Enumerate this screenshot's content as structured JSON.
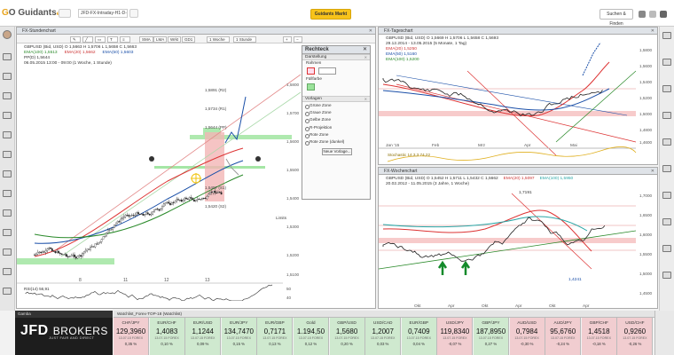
{
  "topbar": {
    "title_field": "JFD-FX-Intraday-H1-D-W",
    "market_button": "Guidants Markt",
    "search_button": "Suchen & Finden"
  },
  "main_chart": {
    "window_title": "FX-Stundenchart",
    "periods": [
      "1 Woche",
      "1 Stunde"
    ],
    "ma_buttons": [
      "SMA",
      "LMA",
      "Wrkt",
      "GD1"
    ],
    "line1": "GBPUSD (Bid, USD) O 1,5663 H 1,5706 L 1,5658 C 1,5663",
    "ema20": "EMA(20) 1,5662",
    "ema50": "EMA(50) 1,5603",
    "ema100": "EMA(100) 1,5513",
    "pp": "PP(D) 1,5644",
    "date": "06.05.2015 13:00 - 09:00 (1 Woche, 1 Stunde)",
    "levels": [
      "1,5891 (R2)",
      "1,5734 (R1)",
      "1,5644 (PP)",
      "1,5497 (S1)",
      "1,5420 (S2)"
    ],
    "yticks": [
      "1,5800",
      "1,5700",
      "1,5600",
      "1,5500",
      "1,5400",
      "1,5300",
      "1,5200",
      "1,5100"
    ],
    "xticks": [
      "8",
      "11",
      "12",
      "13"
    ],
    "rsi_label": "RSI(14) 56,91",
    "rsi_ticks": [
      "50",
      "40"
    ],
    "extra_label": "Limits"
  },
  "rect_panel": {
    "title": "Rechteck",
    "sec_display": "Darstellung",
    "label_frame": "Rahmen",
    "label_fill": "Füllfarbe",
    "sec_templates": "Vorlagen",
    "templates": [
      "Grüne Zone",
      "Graue Zone",
      "Gelbe Zone",
      "R-Projektion",
      "Rote Zone",
      "Rote Zone (dunkel)"
    ],
    "new_button": "Neue Vorlage..."
  },
  "daily_chart": {
    "window_title": "FX-Tageschart",
    "line1": "GBPUSD (Bid, USD) O 1,5669 H 1,5706 L 1,5658 C 1,5693",
    "date": "29.12.2014 - 13.05.2015 (5 Monate, 1 Tag)",
    "ema20": "EMA(20) 1,5250",
    "ema50": "EMA(50) 1,5160",
    "ema100": "EMA(100) 1,5200",
    "yticks": [
      "1,5800",
      "1,5600",
      "1,5400",
      "1,5200",
      "1,5000",
      "1,4800",
      "1,4600"
    ],
    "xticks": [
      "Jan '15",
      "Feb",
      "Mrz",
      "Apr",
      "Mai"
    ],
    "stoch_label": "Stochastic 14,3,3 74,22"
  },
  "weekly_chart": {
    "window_title": "FX-Wochenchart",
    "line1": "GBPUSD (Bid, USD) O 1,5452 H 1,5711 L 1,5432 C 1,5662",
    "date": "20.02.2012 - 11.05.2015 (3 Jahre, 1 Woche)",
    "ema20": "EMA(20) 1,5097",
    "ema100": "EMA(100) 1,5950",
    "high_label": "1,7191",
    "low_label": "1,4241",
    "yticks": [
      "1,7000",
      "1,6500",
      "1,6000",
      "1,5500",
      "1,5000",
      "1,4500"
    ],
    "xticks": [
      "Okt",
      "Apr",
      "Okt",
      "Apr",
      "Okt",
      "Apr"
    ]
  },
  "footer": {
    "tab": "Gamba",
    "logo_text": "JFD",
    "logo_brokers": "BROKERS",
    "logo_sub": "JUST FAIR AND DIRECT",
    "ticker_head": "Watchlist_Forex-TOP-18 (Watchlist)",
    "tickers": [
      {
        "name": "CHF/JPY",
        "price": "129,3960",
        "time": "13.07.15 FOREX",
        "chg": "0,35 %",
        "dir": "down"
      },
      {
        "name": "EUR/CHF",
        "price": "1,4083",
        "time": "13.07.15 FOREX",
        "chg": "0,10 %",
        "dir": "up"
      },
      {
        "name": "EUR/USD",
        "price": "1,1244",
        "time": "13.07.15 FOREX",
        "chg": "0,09 %",
        "dir": "up"
      },
      {
        "name": "EUR/JPY",
        "price": "134,7470",
        "time": "13.07.15 FOREX",
        "chg": "0,15 %",
        "dir": "up"
      },
      {
        "name": "EUR/GBP",
        "price": "0,7171",
        "time": "13.07.15 FOREX",
        "chg": "0,13 %",
        "dir": "up"
      },
      {
        "name": "Gold",
        "price": "1.194,50",
        "time": "13.07.15 FOREX",
        "chg": "0,12 %",
        "dir": "up"
      },
      {
        "name": "GBP/USD",
        "price": "1,5680",
        "time": "13.07.15 FOREX",
        "chg": "0,20 %",
        "dir": "up"
      },
      {
        "name": "USD/CAD",
        "price": "1,2007",
        "time": "13.07.15 FOREX",
        "chg": "0,03 %",
        "dir": "up"
      },
      {
        "name": "EUR/GBP",
        "price": "0,7409",
        "time": "13.07.15 FOREX",
        "chg": "0,04 %",
        "dir": "up"
      },
      {
        "name": "USD/JPY",
        "price": "119,8340",
        "time": "13.07.15 FOREX",
        "chg": "-0,07 %",
        "dir": "down"
      },
      {
        "name": "GBP/JPY",
        "price": "187,8950",
        "time": "13.07.15 FOREX",
        "chg": "0,27 %",
        "dir": "up"
      },
      {
        "name": "AUD/USD",
        "price": "0,7984",
        "time": "13.07.15 FOREX",
        "chg": "-0,30 %",
        "dir": "down"
      },
      {
        "name": "AUD/JPY",
        "price": "95,6760",
        "time": "13.07.15 FOREX",
        "chg": "-0,24 %",
        "dir": "down"
      },
      {
        "name": "GBP/CHF",
        "price": "1,4518",
        "time": "13.07.15 FOREX",
        "chg": "-0,18 %",
        "dir": "down"
      },
      {
        "name": "USD/CHF",
        "price": "0,9260",
        "time": "13.07.15 FOREX",
        "chg": "-0,26 %",
        "dir": "down"
      }
    ]
  },
  "colors": {
    "accent": "#f7c31a",
    "ema20": "#d33333",
    "ema50": "#1a4fa8",
    "ema100": "#2a8a2a",
    "zone_green": "#9be39b",
    "zone_red": "#f3b5b5"
  }
}
